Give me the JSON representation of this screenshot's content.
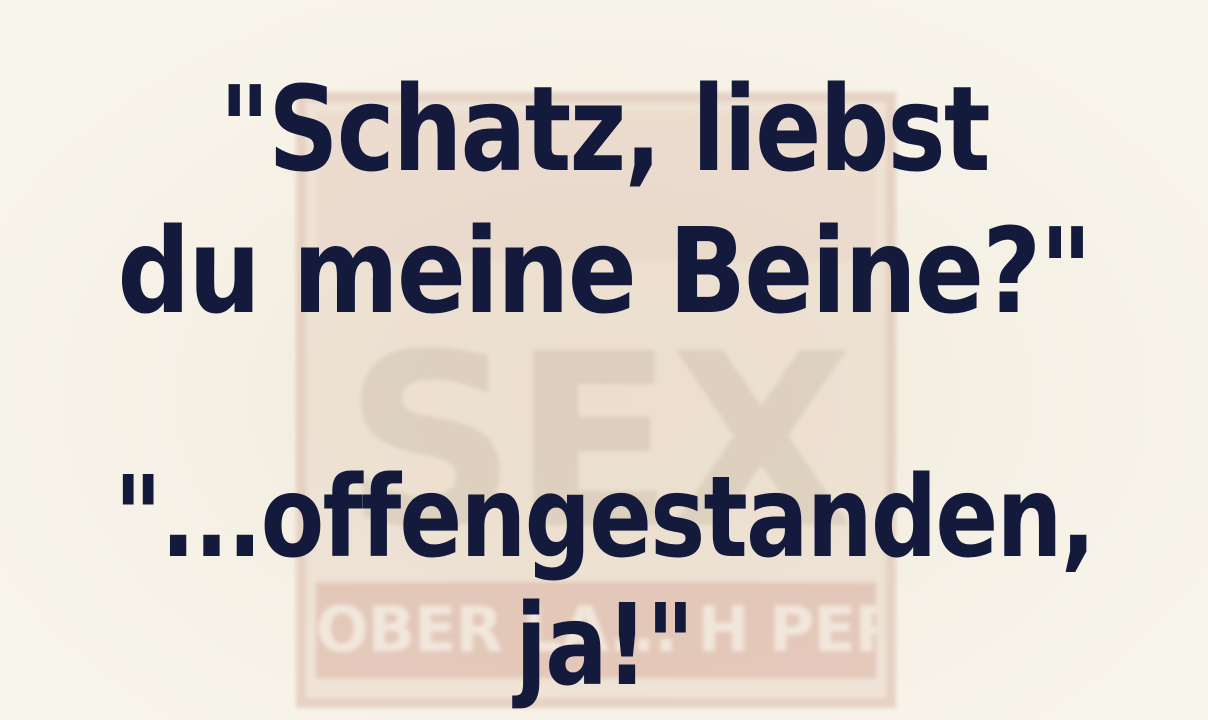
{
  "quote": {
    "line1": "\"Schatz, liebst",
    "line2": "du meine Beine?\"",
    "line3": "\"...offengestanden,",
    "line4": "ja!\""
  },
  "watermark": {
    "center_text": "SEX",
    "bottom_text": "OBER LA... H PERREN"
  },
  "colors": {
    "text": "#141a3c",
    "background": "#f7f3e9"
  }
}
